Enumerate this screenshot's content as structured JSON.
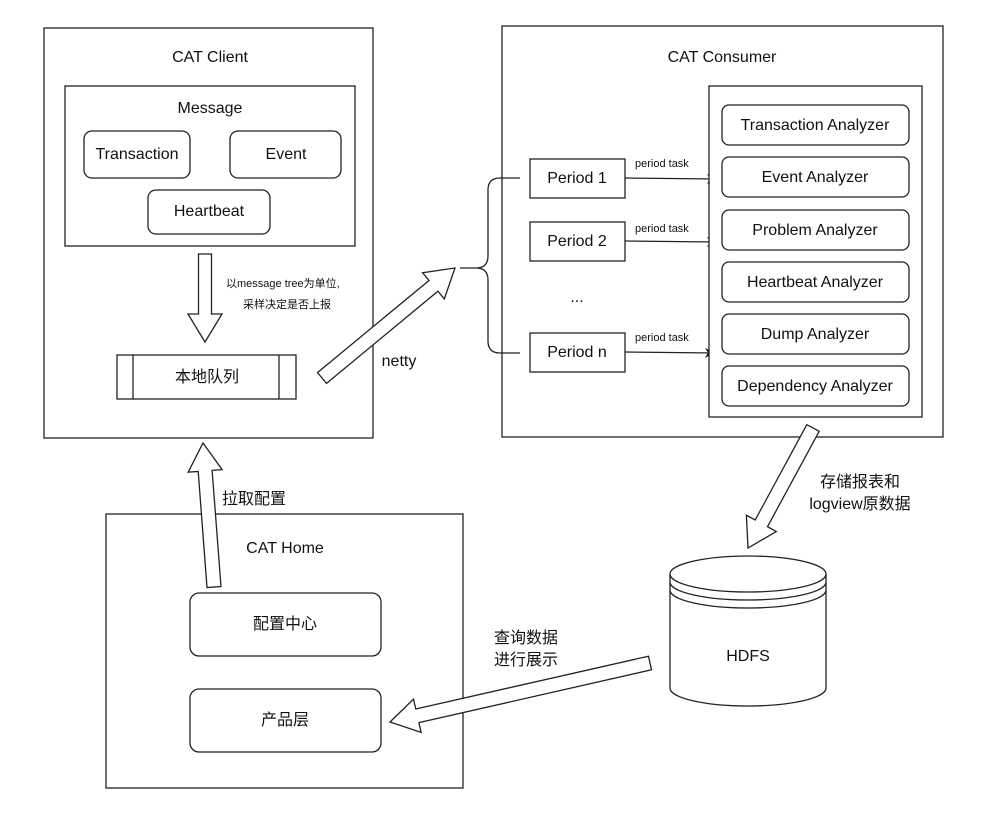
{
  "client": {
    "title": "CAT Client",
    "message": {
      "title": "Message",
      "items": [
        "Transaction",
        "Event",
        "Heartbeat"
      ]
    },
    "sampling_note": [
      "以message tree为单位,",
      "采样决定是否上报"
    ],
    "queue": "本地队列"
  },
  "transport_label": "netty",
  "consumer": {
    "title": "CAT Consumer",
    "periods": [
      "Period 1",
      "Period 2",
      "...",
      "Period n"
    ],
    "task_label": "period task",
    "analyzers": [
      "Transaction Analyzer",
      "Event Analyzer",
      "Problem Analyzer",
      "Heartbeat Analyzer",
      "Dump Analyzer",
      "Dependency Analyzer"
    ]
  },
  "storage_note": [
    "存储报表和",
    "logview原数据"
  ],
  "storage": {
    "label": "HDFS"
  },
  "home": {
    "title": "CAT Home",
    "config_center": "配置中心",
    "product_layer": "产品层"
  },
  "pull_config_label": "拉取配置",
  "query_note": [
    "查询数据",
    "进行展示"
  ]
}
